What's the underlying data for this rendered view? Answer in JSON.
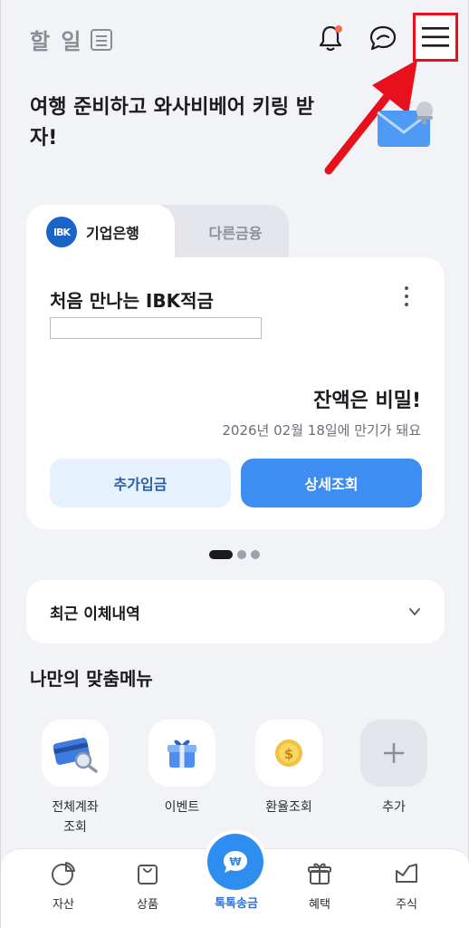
{
  "header": {
    "todo_label": "할 일"
  },
  "promo": {
    "text": "여행 준비하고 와사비베어 키링 받자!"
  },
  "account_tabs": {
    "active": "기업은행",
    "inactive": "다른금융",
    "logo_text": "IBK"
  },
  "account_card": {
    "name": "처음 만나는 IBK적금",
    "balance": "잔액은 비밀!",
    "maturity": "2026년 02월 18일에 만기가 돼요",
    "deposit_button": "추가입금",
    "detail_button": "상세조회"
  },
  "pagination": {
    "pages": 3,
    "current": 1
  },
  "recent_transfers": {
    "label": "최근 이체내역"
  },
  "custom_menu": {
    "title": "나만의 맞춤메뉴",
    "items": [
      {
        "label": "전체계좌\n조회",
        "icon": "account-card-icon"
      },
      {
        "label": "이벤트",
        "icon": "gift-icon"
      },
      {
        "label": "환율조회",
        "icon": "coin-icon"
      },
      {
        "label": "추가",
        "icon": "plus-icon"
      }
    ]
  },
  "bottom_nav": {
    "items": [
      {
        "label": "자산",
        "icon": "pie-chart-icon"
      },
      {
        "label": "상품",
        "icon": "shopping-bag-icon"
      },
      {
        "label": "톡톡송금",
        "icon": "transfer-chat-icon"
      },
      {
        "label": "혜택",
        "icon": "gift-outline-icon"
      },
      {
        "label": "주식",
        "icon": "stock-chart-icon"
      }
    ]
  },
  "colors": {
    "background": "#f2f3f7",
    "accent": "#3d8df2",
    "annotation": "#e8101c"
  }
}
